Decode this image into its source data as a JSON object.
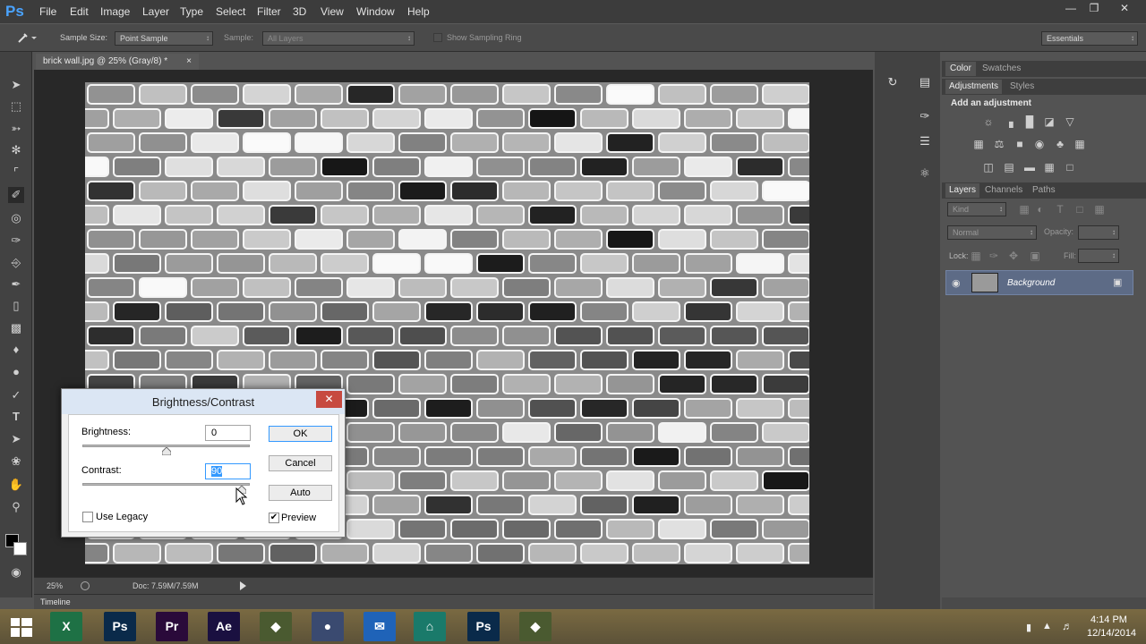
{
  "app": {
    "logo": "Ps"
  },
  "menu": [
    "File",
    "Edit",
    "Image",
    "Layer",
    "Type",
    "Select",
    "Filter",
    "3D",
    "View",
    "Window",
    "Help"
  ],
  "window_controls": {
    "minimize": "—",
    "restore": "❐",
    "close": "✕"
  },
  "options": {
    "sample_size_label": "Sample Size:",
    "sample_size_value": "Point Sample",
    "sample_label": "Sample:",
    "sample_value": "All Layers",
    "show_ring_label": "Show Sampling Ring",
    "workspace": "Essentials"
  },
  "document": {
    "tab_title": "brick wall.jpg @ 25% (Gray/8) *",
    "tab_close": "×",
    "zoom": "25%",
    "doc_size": "Doc: 7.59M/7.59M"
  },
  "timeline": {
    "label": "Timeline"
  },
  "panels": {
    "color_tab": "Color",
    "swatches_tab": "Swatches",
    "adjustments_tab": "Adjustments",
    "styles_tab": "Styles",
    "add_adjustment": "Add an adjustment",
    "layers_tab": "Layers",
    "channels_tab": "Channels",
    "paths_tab": "Paths",
    "kind_filter": "Kind",
    "blend_mode": "Normal",
    "opacity_label": "Opacity:",
    "lock_label": "Lock:",
    "fill_label": "Fill:",
    "layer_name": "Background"
  },
  "dialog": {
    "title": "Brightness/Contrast",
    "close": "✕",
    "brightness_label": "Brightness:",
    "brightness_value": "0",
    "contrast_label": "Contrast:",
    "contrast_value": "90",
    "ok": "OK",
    "cancel": "Cancel",
    "auto": "Auto",
    "use_legacy_label": "Use Legacy",
    "use_legacy_checked": false,
    "preview_label": "Preview",
    "preview_checked": true,
    "brightness_level": 0.5,
    "contrast_level": 0.95
  },
  "taskbar": {
    "apps": [
      {
        "name": "Excel",
        "glyph": "X",
        "color": "#1e7145"
      },
      {
        "name": "Photoshop",
        "glyph": "Ps",
        "color": "#0a2a4a"
      },
      {
        "name": "Premiere",
        "glyph": "Pr",
        "color": "#2a0a3a"
      },
      {
        "name": "After Effects",
        "glyph": "Ae",
        "color": "#1a1040"
      },
      {
        "name": "App",
        "glyph": "◆",
        "color": "#4a5a30"
      },
      {
        "name": "Firefox",
        "glyph": "●",
        "color": "#3a4a70"
      },
      {
        "name": "Mail",
        "glyph": "✉",
        "color": "#1f63b8"
      },
      {
        "name": "App2",
        "glyph": "⌂",
        "color": "#1a7a6a"
      },
      {
        "name": "Photoshop",
        "glyph": "Ps",
        "color": "#0a2a4a"
      },
      {
        "name": "App3",
        "glyph": "◆",
        "color": "#4a5a30"
      }
    ],
    "time": "4:14 PM",
    "date": "12/14/2014"
  }
}
